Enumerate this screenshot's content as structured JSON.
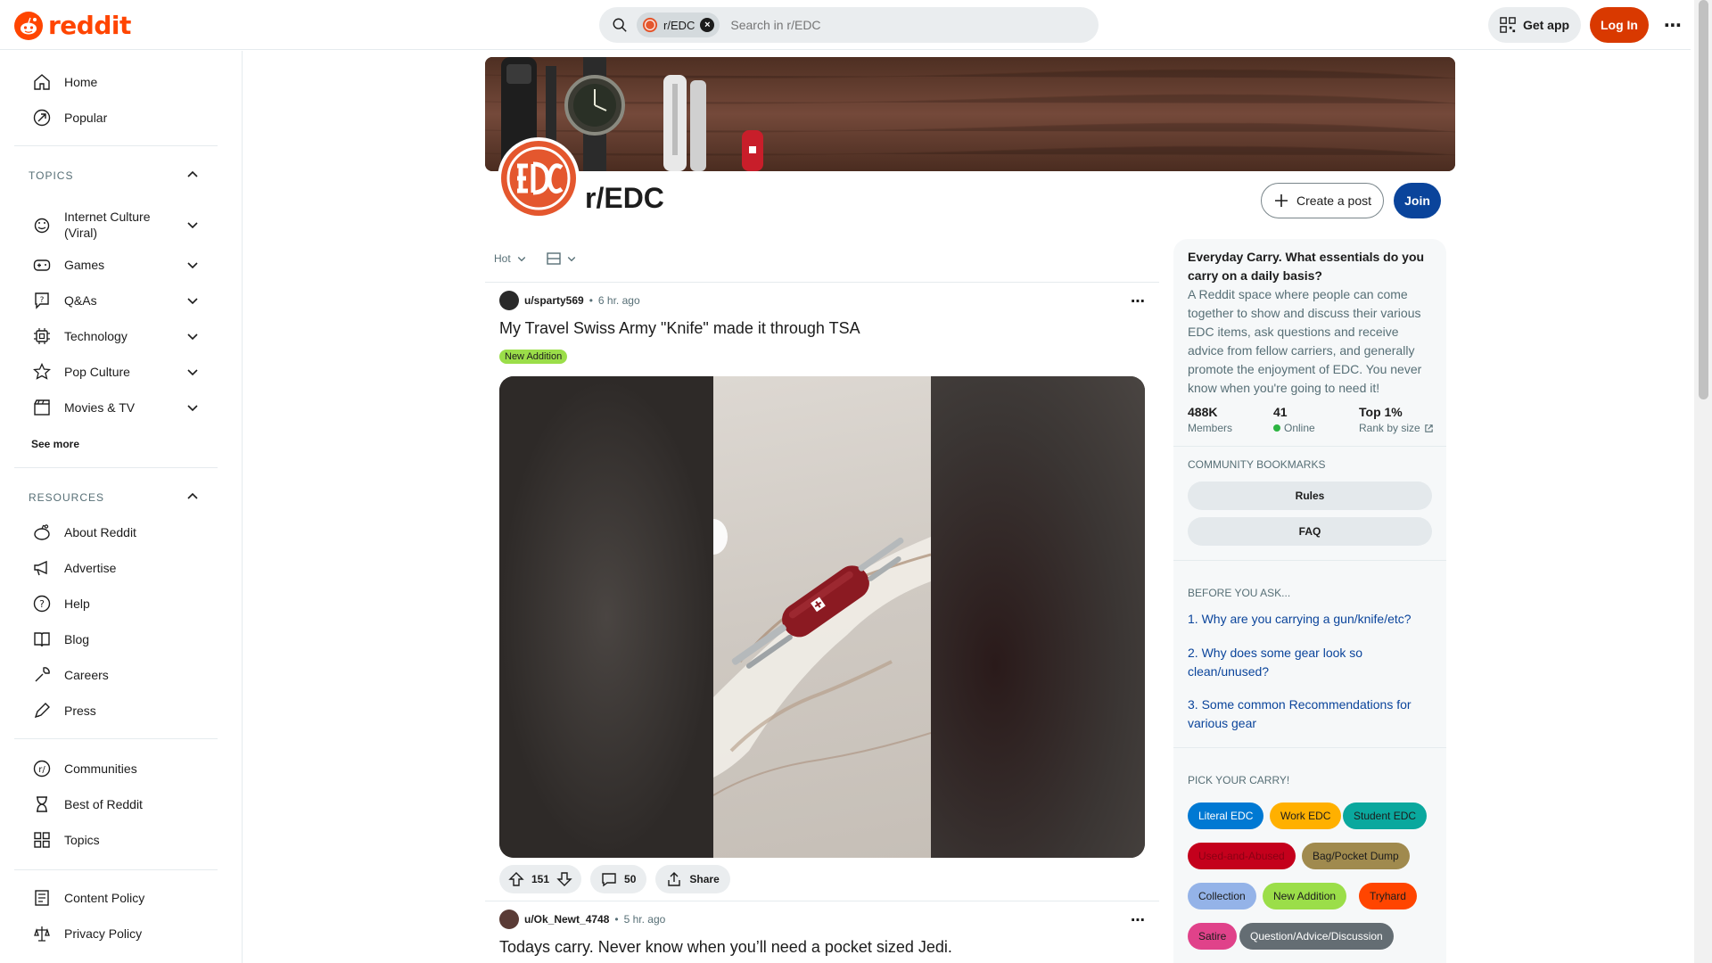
{
  "header": {
    "logo_text": "reddit",
    "search_chip": "r/EDC",
    "search_placeholder": "Search in r/EDC",
    "get_app": "Get app",
    "login": "Log In"
  },
  "sidebar": {
    "top": [
      {
        "label": "Home",
        "icon": "home-icon"
      },
      {
        "label": "Popular",
        "icon": "popular-icon"
      }
    ],
    "topics_title": "TOPICS",
    "topics": [
      {
        "label": "Internet Culture (Viral)",
        "icon": "internet-culture-icon"
      },
      {
        "label": "Games",
        "icon": "games-icon"
      },
      {
        "label": "Q&As",
        "icon": "qa-icon"
      },
      {
        "label": "Technology",
        "icon": "technology-icon"
      },
      {
        "label": "Pop Culture",
        "icon": "pop-culture-icon"
      },
      {
        "label": "Movies & TV",
        "icon": "movies-icon"
      }
    ],
    "see_more": "See more",
    "resources_title": "RESOURCES",
    "resources": [
      {
        "label": "About Reddit",
        "icon": "about-icon"
      },
      {
        "label": "Advertise",
        "icon": "advertise-icon"
      },
      {
        "label": "Help",
        "icon": "help-icon"
      },
      {
        "label": "Blog",
        "icon": "blog-icon"
      },
      {
        "label": "Careers",
        "icon": "careers-icon"
      },
      {
        "label": "Press",
        "icon": "press-icon"
      }
    ],
    "more": [
      {
        "label": "Communities",
        "icon": "communities-icon"
      },
      {
        "label": "Best of Reddit",
        "icon": "best-of-icon"
      },
      {
        "label": "Topics",
        "icon": "topics-icon"
      }
    ],
    "policies": [
      {
        "label": "Content Policy",
        "icon": "content-policy-icon"
      },
      {
        "label": "Privacy Policy",
        "icon": "privacy-policy-icon"
      }
    ]
  },
  "community": {
    "name": "r/EDC",
    "create_post": "Create a post",
    "join": "Join"
  },
  "feed": {
    "sort": "Hot",
    "posts": [
      {
        "author": "u/sparty569",
        "time": "6 hr. ago",
        "title": "My Travel Swiss Army \"Knife\" made it through TSA",
        "flair": "New Addition",
        "votes": "151",
        "comments": "50",
        "share": "Share"
      },
      {
        "author": "u/Ok_Newt_4748",
        "time": "5 hr. ago",
        "title": "Todays carry. Never know when you’ll need a pocket sized Jedi."
      }
    ]
  },
  "about": {
    "title": "Everyday Carry. What essentials do you carry on a daily basis?",
    "description": "A Reddit space where people can come together to show and discuss their various EDC items, ask questions and receive advice from fellow carriers, and generally promote the enjoyment of EDC. You never know when you're going to need it!",
    "members_value": "488K",
    "members_label": "Members",
    "online_value": "41",
    "online_label": "Online",
    "rank_value": "Top 1%",
    "rank_label": "Rank by size",
    "bookmarks_title": "COMMUNITY BOOKMARKS",
    "bookmarks": [
      "Rules",
      "FAQ"
    ],
    "before_title": "BEFORE YOU ASK...",
    "links": [
      "1. Why are you carrying a gun/knife/etc?",
      "2. Why does some gear look so clean/unused?",
      "3. Some common Recommendations for various gear"
    ],
    "pick_title": "PICK YOUR CARRY!",
    "flairs": [
      {
        "label": "Literal EDC",
        "bg": "#0079d3",
        "fg": "#ffffff"
      },
      {
        "label": "Work EDC",
        "bg": "#ffb000",
        "fg": "#1c1c1c"
      },
      {
        "label": "Student EDC",
        "bg": "#0aa89e",
        "fg": "#1c1c1c"
      },
      {
        "label": "Used-and-Abused",
        "bg": "#c4001c",
        "fg": "#8a0014"
      },
      {
        "label": "Bag/Pocket Dump",
        "bg": "#a08a4e",
        "fg": "#1c1c1c"
      },
      {
        "label": "Collection",
        "bg": "#94b3e8",
        "fg": "#1c1c1c"
      },
      {
        "label": "New Addition",
        "bg": "#9bde49",
        "fg": "#1c1c1c"
      },
      {
        "label": "Tryhard",
        "bg": "#ff4500",
        "fg": "#1c1c1c"
      },
      {
        "label": "Satire",
        "bg": "#e0428a",
        "fg": "#1c1c1c"
      },
      {
        "label": "Question/Advice/Discussion",
        "bg": "#646d73",
        "fg": "#ffffff"
      }
    ],
    "accent_online": "#2db542"
  }
}
